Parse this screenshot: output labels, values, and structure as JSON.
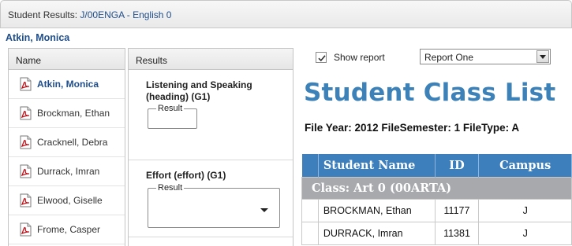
{
  "window": {
    "title_prefix": "Student Results: ",
    "title_link": "J/00ENGA - English 0"
  },
  "student_header": "Atkin, Monica",
  "name_column": {
    "header": "Name",
    "items": [
      {
        "label": "Atkin, Monica",
        "active": true
      },
      {
        "label": "Brockman, Ethan",
        "active": false
      },
      {
        "label": "Cracknell, Debra",
        "active": false
      },
      {
        "label": "Durrack, Imran",
        "active": false
      },
      {
        "label": "Elwood, Giselle",
        "active": false
      },
      {
        "label": "Frome, Casper",
        "active": false
      }
    ]
  },
  "results_column": {
    "header": "Results",
    "blocks": [
      {
        "title": "Listening and Speaking (heading) (G1)",
        "field_label": "Result"
      },
      {
        "title": "Effort (effort) (G1)",
        "field_label": "Result",
        "value": ""
      }
    ]
  },
  "report_controls": {
    "show_report_label": "Show report",
    "show_report_checked": true,
    "report_select_value": "Report One"
  },
  "report": {
    "title": "Student Class List",
    "subtitle": "File Year: 2012 FileSemester: 1 FileType: A",
    "table": {
      "columns": [
        "",
        "Student Name",
        "ID",
        "Campus"
      ],
      "class_row": "Class: Art 0 (00ARTA)",
      "rows": [
        {
          "name": "BROCKMAN, Ethan",
          "id": "11177",
          "campus": "J"
        },
        {
          "name": "DURRACK, Imran",
          "id": "11381",
          "campus": "J"
        }
      ]
    }
  },
  "colors": {
    "accent_link": "#1f4e8c",
    "report_title": "#3c82b8",
    "table_header": "#3d7ebc",
    "class_row": "#a7a9ad"
  },
  "icons": {
    "student_item": "pdf-file-icon",
    "checkbox": "checkmark-icon",
    "dropdown": "chevron-down-icon"
  }
}
